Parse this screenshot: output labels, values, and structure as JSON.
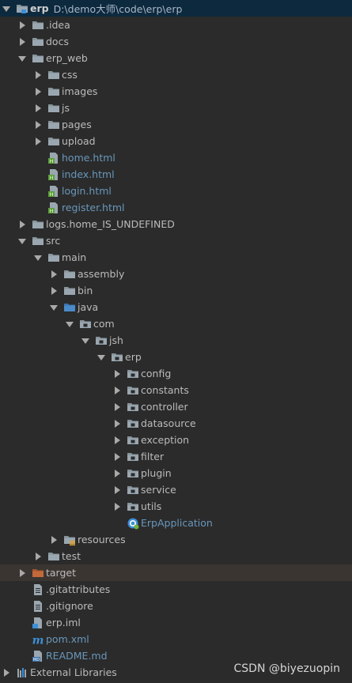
{
  "project": {
    "name": "erp",
    "path": "D:\\demo大师\\code\\erp\\erp"
  },
  "tree": [
    {
      "label": "erp",
      "path": "D:\\demo大师\\code\\erp\\erp",
      "depth": 0,
      "expanded": true,
      "icon": "module-folder-icon",
      "name": "tree-node-erp",
      "cls": "root",
      "selected": true
    },
    {
      "label": ".idea",
      "depth": 1,
      "expanded": false,
      "icon": "folder-icon",
      "name": "tree-node-idea"
    },
    {
      "label": "docs",
      "depth": 1,
      "expanded": false,
      "icon": "folder-icon",
      "name": "tree-node-docs"
    },
    {
      "label": "erp_web",
      "depth": 1,
      "expanded": true,
      "icon": "folder-icon",
      "name": "tree-node-erp-web"
    },
    {
      "label": "css",
      "depth": 2,
      "expanded": false,
      "icon": "folder-icon",
      "name": "tree-node-css"
    },
    {
      "label": "images",
      "depth": 2,
      "expanded": false,
      "icon": "folder-icon",
      "name": "tree-node-images"
    },
    {
      "label": "js",
      "depth": 2,
      "expanded": false,
      "icon": "folder-icon",
      "name": "tree-node-js"
    },
    {
      "label": "pages",
      "depth": 2,
      "expanded": false,
      "icon": "folder-icon",
      "name": "tree-node-pages"
    },
    {
      "label": "upload",
      "depth": 2,
      "expanded": false,
      "icon": "folder-icon",
      "name": "tree-node-upload"
    },
    {
      "label": "home.html",
      "depth": 2,
      "icon": "html-file-icon",
      "name": "tree-node-home-html",
      "cls": "html"
    },
    {
      "label": "index.html",
      "depth": 2,
      "icon": "html-file-icon",
      "name": "tree-node-index-html",
      "cls": "html"
    },
    {
      "label": "login.html",
      "depth": 2,
      "icon": "html-file-icon",
      "name": "tree-node-login-html",
      "cls": "html"
    },
    {
      "label": "register.html",
      "depth": 2,
      "icon": "html-file-icon",
      "name": "tree-node-register-html",
      "cls": "html"
    },
    {
      "label": "logs.home_IS_UNDEFINED",
      "depth": 1,
      "expanded": false,
      "icon": "folder-icon",
      "name": "tree-node-logs"
    },
    {
      "label": "src",
      "depth": 1,
      "expanded": true,
      "icon": "folder-icon",
      "name": "tree-node-src"
    },
    {
      "label": "main",
      "depth": 2,
      "expanded": true,
      "icon": "folder-icon",
      "name": "tree-node-main"
    },
    {
      "label": "assembly",
      "depth": 3,
      "expanded": false,
      "icon": "folder-icon",
      "name": "tree-node-assembly"
    },
    {
      "label": "bin",
      "depth": 3,
      "expanded": false,
      "icon": "folder-icon",
      "name": "tree-node-bin"
    },
    {
      "label": "java",
      "depth": 3,
      "expanded": true,
      "icon": "source-folder-icon",
      "name": "tree-node-java"
    },
    {
      "label": "com",
      "depth": 4,
      "expanded": true,
      "icon": "package-icon",
      "name": "tree-node-com"
    },
    {
      "label": "jsh",
      "depth": 5,
      "expanded": true,
      "icon": "package-icon",
      "name": "tree-node-jsh"
    },
    {
      "label": "erp",
      "depth": 6,
      "expanded": true,
      "icon": "package-icon",
      "name": "tree-node-erp-package"
    },
    {
      "label": "config",
      "depth": 7,
      "expanded": false,
      "icon": "package-icon",
      "name": "tree-node-config"
    },
    {
      "label": "constants",
      "depth": 7,
      "expanded": false,
      "icon": "package-icon",
      "name": "tree-node-constants"
    },
    {
      "label": "controller",
      "depth": 7,
      "expanded": false,
      "icon": "package-icon",
      "name": "tree-node-controller"
    },
    {
      "label": "datasource",
      "depth": 7,
      "expanded": false,
      "icon": "package-icon",
      "name": "tree-node-datasource"
    },
    {
      "label": "exception",
      "depth": 7,
      "expanded": false,
      "icon": "package-icon",
      "name": "tree-node-exception"
    },
    {
      "label": "filter",
      "depth": 7,
      "expanded": false,
      "icon": "package-icon",
      "name": "tree-node-filter"
    },
    {
      "label": "plugin",
      "depth": 7,
      "expanded": false,
      "icon": "package-icon",
      "name": "tree-node-plugin"
    },
    {
      "label": "service",
      "depth": 7,
      "expanded": false,
      "icon": "package-icon",
      "name": "tree-node-service"
    },
    {
      "label": "utils",
      "depth": 7,
      "expanded": false,
      "icon": "package-icon",
      "name": "tree-node-utils"
    },
    {
      "label": "ErpApplication",
      "depth": 7,
      "icon": "spring-class-icon",
      "name": "tree-node-erp-application",
      "cls": "blue"
    },
    {
      "label": "resources",
      "depth": 3,
      "expanded": false,
      "icon": "resources-folder-icon",
      "name": "tree-node-resources"
    },
    {
      "label": "test",
      "depth": 2,
      "expanded": false,
      "icon": "folder-icon",
      "name": "tree-node-test"
    },
    {
      "label": "target",
      "depth": 1,
      "expanded": false,
      "icon": "excluded-folder-icon",
      "name": "tree-node-target",
      "excluded": true
    },
    {
      "label": ".gitattributes",
      "depth": 1,
      "icon": "text-file-icon",
      "name": "tree-node-gitattributes"
    },
    {
      "label": ".gitignore",
      "depth": 1,
      "icon": "text-file-icon",
      "name": "tree-node-gitignore"
    },
    {
      "label": "erp.iml",
      "depth": 1,
      "icon": "iml-file-icon",
      "name": "tree-node-erp-iml"
    },
    {
      "label": "pom.xml",
      "depth": 1,
      "icon": "maven-icon",
      "name": "tree-node-pom-xml",
      "cls": "xml"
    },
    {
      "label": "README.md",
      "depth": 1,
      "icon": "markdown-file-icon",
      "name": "tree-node-readme",
      "cls": "md"
    },
    {
      "label": "External Libraries",
      "depth": 0,
      "expanded": false,
      "icon": "libraries-icon",
      "name": "tree-node-external-libraries"
    }
  ],
  "watermark": "CSDN @biyezuopin",
  "colors": {
    "background": "#2b2b2b",
    "selection": "#0d293e",
    "excluded_row": "#3b3532",
    "text": "#bbbbbb",
    "link_blue": "#6897bb",
    "folder": "#87939a",
    "source_folder": "#4a8ac8",
    "excluded_folder": "#c4693a"
  }
}
